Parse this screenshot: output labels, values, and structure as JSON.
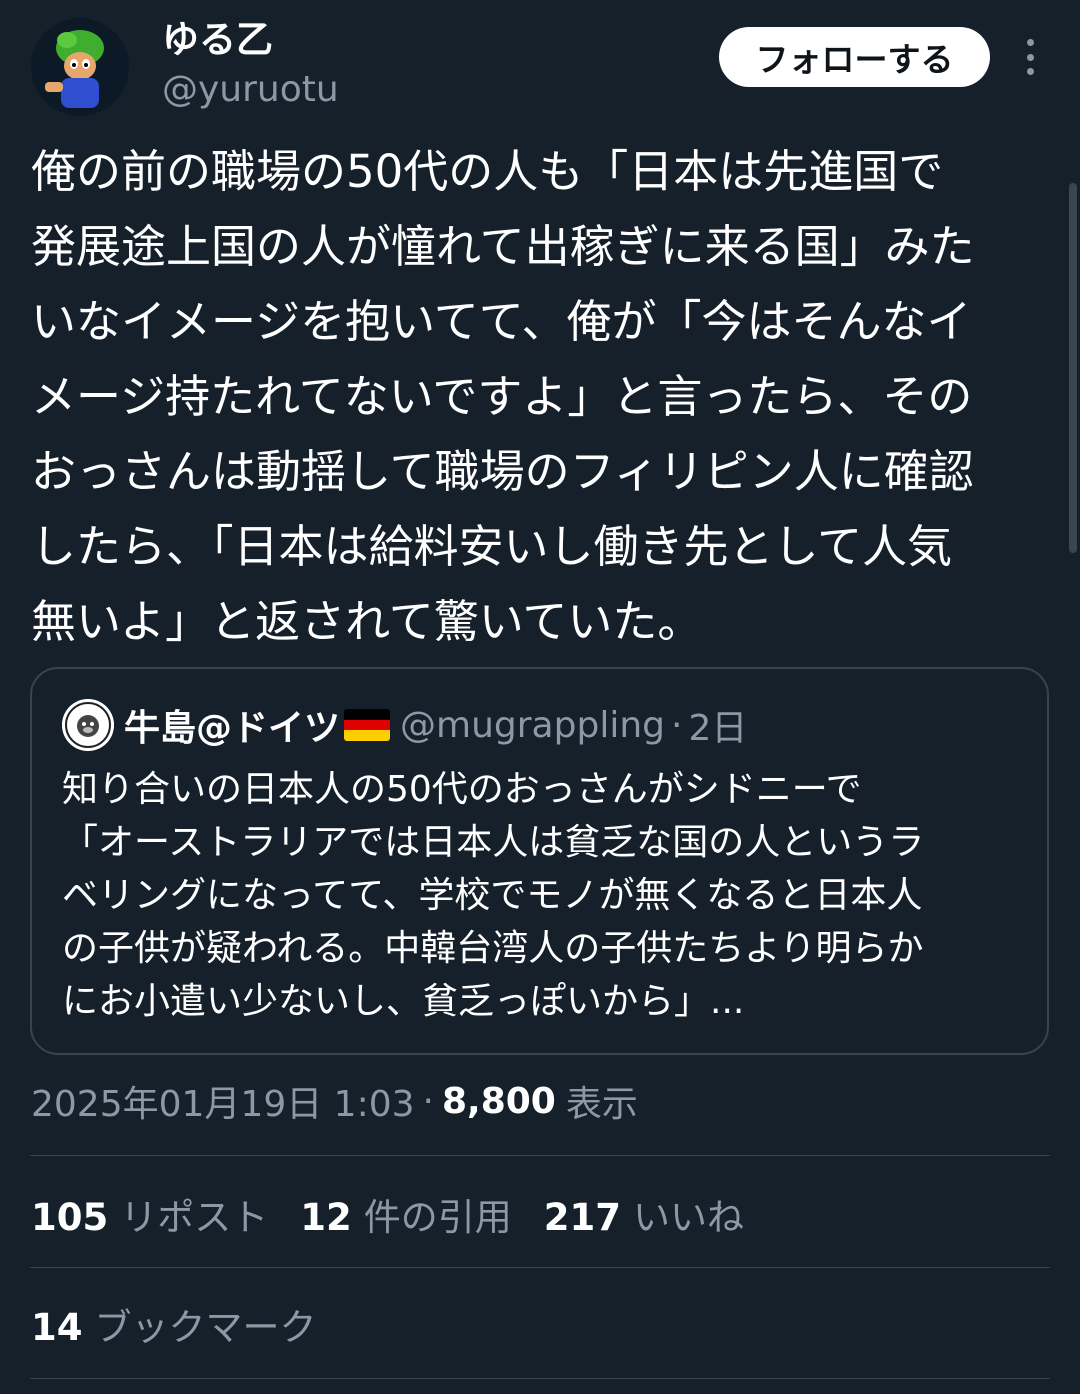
{
  "author": {
    "display_name": "ゆる乙",
    "handle": "@yuruotu",
    "avatar_icon": "cartoon-character-avatar-icon"
  },
  "follow_button_label": "フォローする",
  "more_icon": "more-vertical-icon",
  "tweet_text": "俺の前の職場の50代の人も「日本は先進国で\n発展途上国の人が憧れて出稼ぎに来る国」みた\nいなイメージを抱いてて、俺が「今はそんなイ\nメージ持たれてないですよ」と言ったら、その\nおっさんは動揺して職場のフィリピン人に確認\nしたら、「日本は給料安いし働き先として人気\n無いよ」と返されて驚いていた。",
  "quote": {
    "avatar_icon": "monkey-logo-avatar-icon",
    "name": "牛島@ドイツ",
    "flag_icon": "germany-flag-icon",
    "handle": "@mugrappling",
    "separator": "·",
    "time": "2日",
    "text": "知り合いの日本人の50代のおっさんがシドニーで\n「オーストラリアでは日本人は貧乏な国の人というラ\nベリングになってて、学校でモノが無くなると日本人\nの子供が疑われる。中韓台湾人の子供たちより明らか\nにお小遣い少ないし、貧乏っぽいから」..."
  },
  "meta": {
    "timestamp": "2025年01月19日 1:03",
    "separator": "·",
    "views_count": "8,800",
    "views_label": "表示"
  },
  "stats": {
    "reposts": {
      "count": "105",
      "label": "リポスト"
    },
    "quotes": {
      "count": "12",
      "label": "件の引用"
    },
    "likes": {
      "count": "217",
      "label": "いいね"
    },
    "bookmarks": {
      "count": "14",
      "label": "ブックマーク"
    }
  },
  "colors": {
    "background": "#15202b",
    "text_primary": "#ffffff",
    "text_secondary": "#8b98a5",
    "border": "#38444d",
    "follow_button_bg": "#ffffff"
  }
}
